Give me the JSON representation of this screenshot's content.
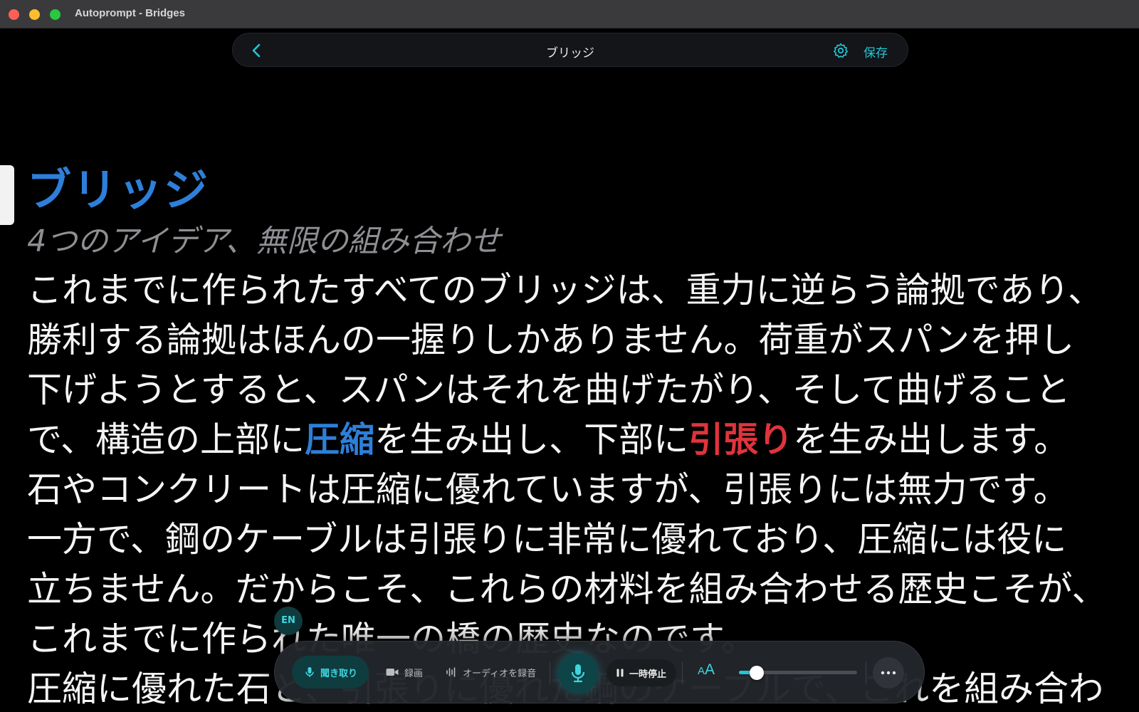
{
  "window": {
    "title": "Autoprompt - Bridges"
  },
  "topbar": {
    "back_icon": "chevron-left-icon",
    "title": "ブリッジ",
    "settings_icon": "gear-icon",
    "save_label": "保存"
  },
  "document": {
    "title": "ブリッジ",
    "subtitle": "4つのアイデア、無限の組み合わせ",
    "lines": [
      "これまでに作られたすべてのブリッジは、重力に逆らう論拠であり、",
      "勝利する論拠はほんの一握りしかありません。荷重がスパンを押し",
      "下げようとすると、スパンはそれを曲げたがり、そして曲げること",
      "で、構造の上部に",
      "圧縮",
      "を生み出し、下部に",
      "引張り",
      "を生み出します。",
      "石やコンクリートは圧縮に優れていますが、引張りには無力です。",
      "一方で、鋼のケーブルは引張りに非常に優れており、圧縮には役に",
      "立ちません。だからこそ、これらの材料を組み合わせる歴史こそが、",
      "これまでに作られた唯一の橋の歴史なのです。",
      "圧縮に優れた石と、引張りに優れた鋼のケーブルで、これを組み合わ"
    ],
    "highlight_colors": {
      "compression": "#2e7fd9",
      "tension": "#e0343c"
    }
  },
  "language_badge": "EN",
  "controls": {
    "listen_label": "聞き取り",
    "record_label": "録画",
    "audio_record_label": "オーディオを録音",
    "pause_label": "一時停止",
    "font_size_label_small": "A",
    "font_size_label_large": "A",
    "speed_level": 0.15,
    "accent_color": "#22c7d6"
  }
}
